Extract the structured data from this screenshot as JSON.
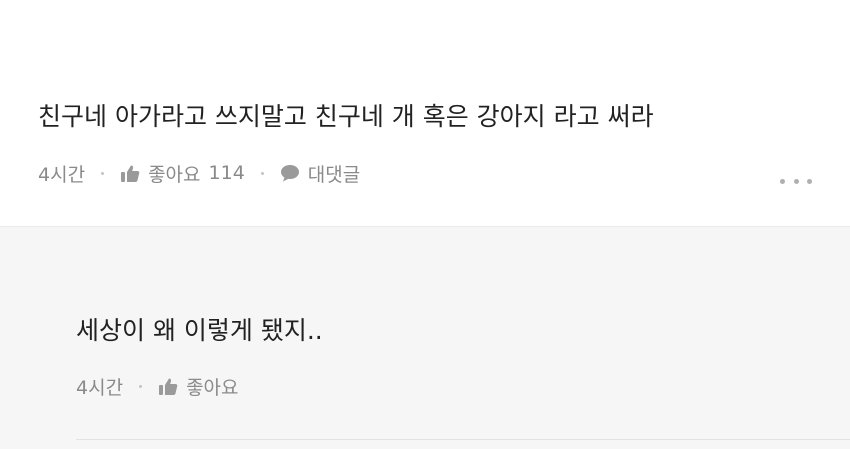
{
  "comment": {
    "text": "친구네 아가라고 쓰지말고 친구네 개 혹은 강아지 라고 써라",
    "time": "4시간",
    "like_label": "좋아요",
    "like_count": "114",
    "reply_label": "대댓글",
    "more_icon": "more-dots-icon"
  },
  "reply": {
    "text": "세상이 왜 이렇게 됐지..",
    "time": "4시간",
    "like_label": "좋아요"
  },
  "colors": {
    "meta_text": "#8a8a8a",
    "reply_background": "#f6f6f6",
    "body_text": "#222222"
  }
}
